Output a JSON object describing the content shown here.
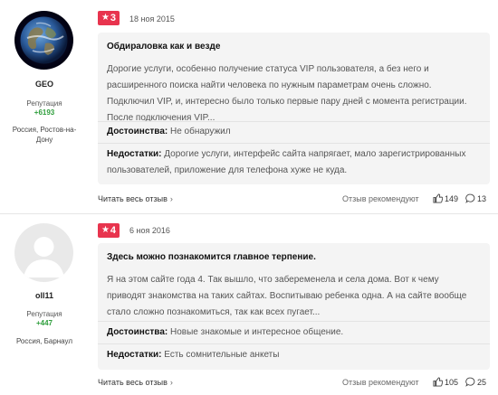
{
  "reviews": [
    {
      "author": {
        "name": "GEO",
        "reputation_label": "Репутация",
        "reputation_value": "+6193",
        "location": "Россия, Ростов-на-Дону",
        "avatar": "earth-globe-avatar"
      },
      "rating": "3",
      "date": "18 ноя 2015",
      "title": "Обдираловка как и везде",
      "text": "Дорогие услуги, особенно получение статуса VIP пользователя, а без него и расширенного поиска найти человека по нужным параметрам очень сложно. Подключил VIP, и, интересно было только первые пару дней с момента регистрации. После подключения VIP...",
      "pros_label": "Достоинства:",
      "pros": "Не обнаружил",
      "cons_label": "Недостатки:",
      "cons": "Дорогие услуги, интерфейс сайта напрягает, мало зарегистрированных пользователей, приложение для телефона хуже не куда.",
      "read_more": "Читать весь отзыв",
      "recommend": "Отзыв рекомендуют",
      "likes": "149",
      "comments": "13"
    },
    {
      "author": {
        "name": "oll11",
        "reputation_label": "Репутация",
        "reputation_value": "+447",
        "location": "Россия, Барнаул",
        "avatar": "default-user-avatar"
      },
      "rating": "4",
      "date": "6 ноя 2016",
      "title": "Здесь можно познакомится главное терпение.",
      "text": "Я на этом сайте года 4. Так вышло, что забеременела и села дома. Вот к чему приводят знакомства на таких сайтах. Воспитываю ребенка одна. А на сайте вообще стало сложно познакомиться, так как всех пугает...",
      "pros_label": "Достоинства:",
      "pros": "Новые знакомые и интересное общение.",
      "cons_label": "Недостатки:",
      "cons": "Есть сомнительные анкеты",
      "read_more": "Читать весь отзыв",
      "recommend": "Отзыв рекомендуют",
      "likes": "105",
      "comments": "25"
    }
  ],
  "icons": {
    "star": "star-icon",
    "chevron": "chevron-right-icon",
    "thumb": "thumbs-up-icon",
    "comment": "comment-bubble-icon"
  },
  "colors": {
    "rating_badge": "#e8344e",
    "reputation": "#2e9e3c",
    "card_bg": "#f4f4f4"
  }
}
